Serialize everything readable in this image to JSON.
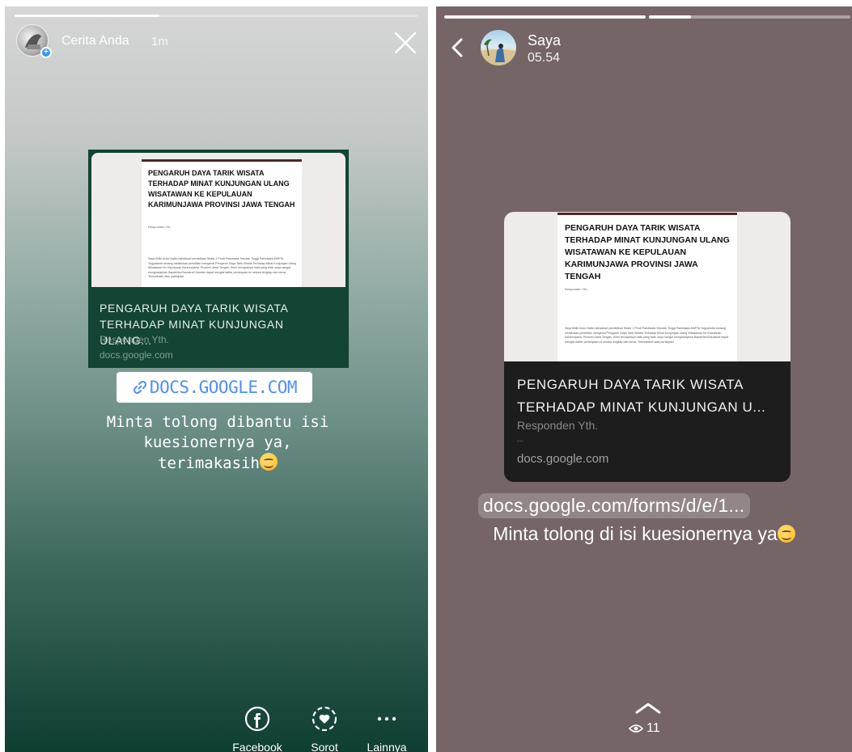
{
  "left_story": {
    "username": "Cerita Anda",
    "time": "1m",
    "progress": 0.36,
    "link_card": {
      "doc_title": "PENGARUH DAYA TARIK WISATA TERHADAP MINAT KUNJUNGAN ULANG WISATAWAN KE KEPULAUAN KARIMUNJAWA PROVINSI JAWA TENGAH",
      "doc_sub": "Responden Yth.",
      "doc_body": "Saya Brilie Ariun Nafis mahasiswi pendidikan Strata 1 Prodi Pariwisata Sekolah Tinggi Pariwisata AMPTA Yogyakarta sedang melakukan penelitian mengenai Pengaruh Daya Tarik Wisata Terhadap Minat Kunjungan Ulang Wisatawan Ke Kepulauan Karimunjawa, Provinsi Jawa Tengah. Demi tercapainya hasil yang baik, saya sangat mengharapkan Bapak/Ibu/Saudara/i Saudari dapat mengisi daftar pertanyaan ini secara lengkap dan benar. Terimakasih atas partisipasi",
      "title": "PENGARUH DAYA TARIK WISATA TERHADAP MINAT KUNJUNGAN ULANG...",
      "subtitle": "Responden Yth.",
      "domain": "docs.google.com"
    },
    "link_sticker": "DOCS.GOOGLE.COM",
    "caption": "Minta tolong dibantu isi\nkuesionernya ya,\nterimakasih",
    "actions": [
      {
        "label": "Facebook",
        "icon": "facebook-icon"
      },
      {
        "label": "Sorot",
        "icon": "highlight-heart-icon"
      },
      {
        "label": "Lainnya",
        "icon": "more-dots-icon"
      }
    ]
  },
  "right_status": {
    "username": "Saya",
    "time": "05.54",
    "link_card": {
      "doc_title": "PENGARUH DAYA TARIK WISATA TERHADAP MINAT KUNJUNGAN ULANG WISATAWAN KE KEPULAUAN KARIMUNJAWA PROVINSI JAWA TENGAH",
      "doc_sub": "Responden Yth.",
      "doc_body": "Saya Brilie Ariun Nafis mahasiswi pendidikan Strata 1 Prodi Pariwisata Sekolah Tinggi Pariwisata AMPTA Yogyakarta sedang melakukan penelitian mengenai Pengaruh Daya Tarik Wisata Terhadap Minat Kunjungan Ulang Wisatawan Ke Kepulauan Karimunjawa, Provinsi Jawa Tengah. Demi tercapainya hasil yang baik, saya sangat mengharapkan Bapak/Ibu/Saudara/i dapat mengisi daftar pertanyaan ini secara lengkap dan benar. Terimakasih atas partisipasi",
      "title": "PENGARUH DAYA TARIK WISATA TERHADAP MINAT KUNJUNGAN U...",
      "subtitle": "Responden Yth.",
      "ellipsis": "...",
      "domain": "docs.google.com"
    },
    "url": "docs.google.com/forms/d/e/1...",
    "caption": "Minta tolong di isi kuesionernya ya",
    "views": "11"
  },
  "colors": {
    "left_card_bg": "#134434",
    "link_blue": "#4f8ef7",
    "right_bg": "#756567",
    "right_card_bg": "#1d1d1d"
  }
}
